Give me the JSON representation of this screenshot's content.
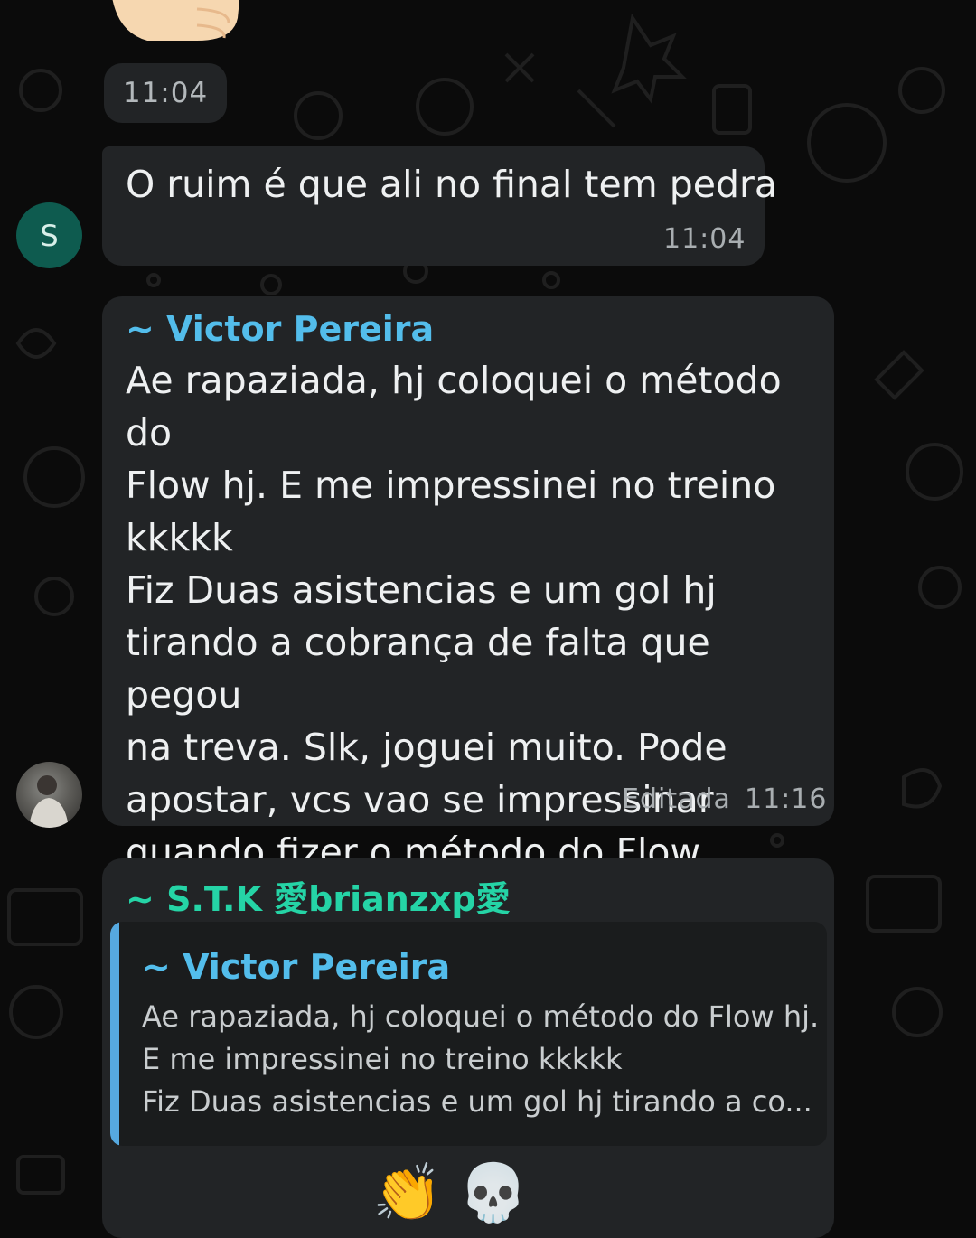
{
  "colors": {
    "bubble": "#222426",
    "sender_victor": "#53bdeb",
    "sender_stk": "#25d4a6",
    "avatar_s": "#0e5b4f",
    "quote_bar": "#56a9e0"
  },
  "messages": [
    {
      "time": "11:04"
    },
    {
      "avatar_initial": "S",
      "text": "O ruim é que ali no final tem pedra",
      "time": "11:04"
    },
    {
      "sender": "~ Victor Pereira",
      "lines": [
        "Ae rapaziada, hj coloquei o método do",
        "Flow hj. E me impressinei no treino",
        "kkkkk",
        "Fiz Duas asistencias e um gol hj",
        "tirando a cobrança de falta que pegou",
        "na treva. Slk, joguei muito. Pode",
        "apostar, vcs vao se impressinar",
        "quando fizer o método do Flow"
      ],
      "edited_label": "Editada",
      "time": "11:16"
    },
    {
      "sender": "~ S.T.K 愛brianzxp愛",
      "quote": {
        "sender": "~ Victor Pereira",
        "lines": [
          "Ae rapaziada, hj coloquei o método do Flow hj.",
          "E me impressinei no treino kkkkk",
          "Fiz Duas asistencias e um gol hj tirando a co..."
        ]
      },
      "emojis": "👏💀"
    }
  ]
}
